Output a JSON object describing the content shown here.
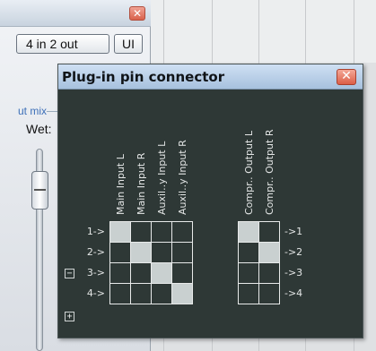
{
  "background_window": {
    "io_button_label": "4 in 2 out",
    "ui_button_label": "UI",
    "mix_label": "ut mix",
    "wet_label": "Wet:",
    "close_glyph": "✕"
  },
  "dialog": {
    "title": "Plug-in pin connector",
    "close_glyph": "✕",
    "input_columns": [
      "Main Input L",
      "Main Input R",
      "Auxil..y Input L",
      "Auxil..y Input R"
    ],
    "output_columns": [
      "Compr.. Output L",
      "Compr.. Output R"
    ],
    "input_rows": [
      "1->",
      "2->",
      "3->",
      "4->"
    ],
    "output_rows": [
      "->1",
      "->2",
      "->3",
      "->4"
    ],
    "input_matrix": [
      [
        1,
        0,
        0,
        0
      ],
      [
        0,
        1,
        0,
        0
      ],
      [
        0,
        0,
        1,
        0
      ],
      [
        0,
        0,
        0,
        1
      ]
    ],
    "output_matrix": [
      [
        1,
        0
      ],
      [
        0,
        1
      ],
      [
        0,
        0
      ],
      [
        0,
        0
      ]
    ],
    "collapse_glyph": "−",
    "expand_glyph": "+"
  }
}
